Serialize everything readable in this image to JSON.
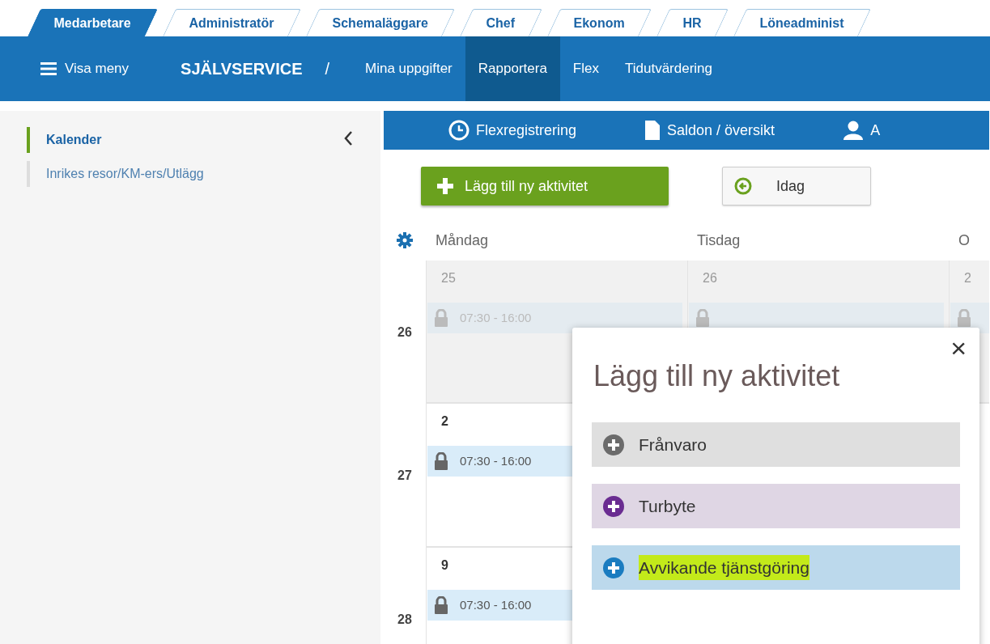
{
  "role_tabs": [
    {
      "label": "Medarbetare",
      "selected": true
    },
    {
      "label": "Administratör",
      "selected": false
    },
    {
      "label": "Schemaläggare",
      "selected": false
    },
    {
      "label": "Chef",
      "selected": false
    },
    {
      "label": "Ekonom",
      "selected": false
    },
    {
      "label": "HR",
      "selected": false
    },
    {
      "label": "Löneadminist",
      "selected": false
    }
  ],
  "navbar": {
    "menu_label": "Visa meny",
    "section": "SJÄLVSERVICE",
    "separator": "/",
    "items": [
      {
        "label": "Mina uppgifter",
        "selected": false
      },
      {
        "label": "Rapportera",
        "selected": true
      },
      {
        "label": "Flex",
        "selected": false
      },
      {
        "label": "Tidutvärdering",
        "selected": false
      }
    ]
  },
  "sidebar": {
    "items": [
      {
        "label": "Kalender",
        "selected": true
      },
      {
        "label": "Inrikes resor/KM-ers/Utlägg",
        "selected": false
      }
    ]
  },
  "subnav": {
    "items": [
      {
        "label": "Flexregistrering",
        "kind": "clock"
      },
      {
        "label": "Saldon / översikt",
        "kind": "document"
      },
      {
        "label": "A",
        "kind": "person"
      }
    ]
  },
  "toolbar": {
    "add_button": "Lägg till ny aktivitet",
    "today_button": "Idag"
  },
  "calendar": {
    "days": [
      "Måndag",
      "Tisdag",
      "O"
    ],
    "weeks": [
      {
        "number": "26",
        "past": true,
        "cells": [
          {
            "date": "25",
            "entries": [
              {
                "time": "07:30 - 16:00",
                "locked": true
              }
            ]
          },
          {
            "date": "26",
            "entries": [
              {
                "locked": true
              }
            ]
          },
          {
            "date": "2",
            "entries": [
              {
                "locked": true
              }
            ]
          }
        ]
      },
      {
        "number": "27",
        "past": false,
        "cells": [
          {
            "date": "2",
            "entries": [
              {
                "time": "07:30 - 16:00",
                "locked": true
              }
            ]
          }
        ]
      },
      {
        "number": "28",
        "past": false,
        "cells": [
          {
            "date": "9",
            "entries": [
              {
                "time": "07:30 - 16:00",
                "locked": true
              }
            ]
          }
        ]
      }
    ]
  },
  "dialog": {
    "title": "Lägg till ny aktivitet",
    "close": "×",
    "options": [
      {
        "label": "Frånvaro",
        "color": "#6b6b6b",
        "highlighted": false
      },
      {
        "label": "Turbyte",
        "color": "#6a2c91",
        "highlighted": false
      },
      {
        "label": "Avvikande tjänstgöring",
        "color": "#1a7cc0",
        "highlighted": true
      }
    ]
  }
}
